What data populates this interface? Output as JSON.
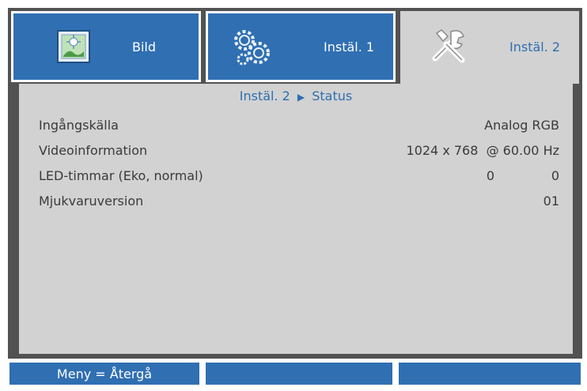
{
  "tabs": [
    {
      "label": "Bild",
      "icon": "picture-icon"
    },
    {
      "label": "Instäl. 1",
      "icon": "gears-icon"
    },
    {
      "label": "Instäl. 2",
      "icon": "tools-icon",
      "active": true
    }
  ],
  "breadcrumb": {
    "parent": "Instäl. 2",
    "current": "Status"
  },
  "rows": [
    {
      "label": "Ingångskälla",
      "value": "Analog RGB"
    },
    {
      "label": "Videoinformation",
      "value": "1024 x 768  @ 60.00 Hz"
    },
    {
      "label": "LED-timmar (Eko, normal)",
      "value_eco": "0",
      "value_normal": "0"
    },
    {
      "label": "Mjukvaruversion",
      "value": "01"
    }
  ],
  "footer": {
    "hint": "Meny = Återgå",
    "mid": "",
    "right": ""
  },
  "colors": {
    "accent": "#2f6fb2",
    "panel": "#d2d2d2",
    "frame": "#525252"
  }
}
